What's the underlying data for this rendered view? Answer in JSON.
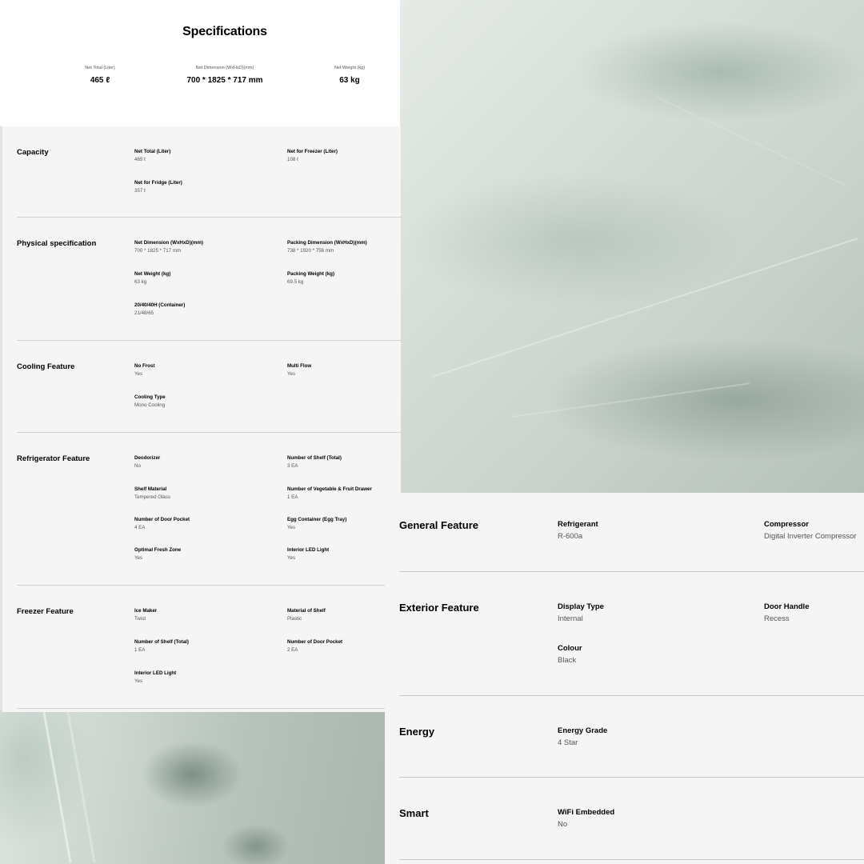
{
  "title": "Specifications",
  "summary": [
    {
      "label": "Net Total (Liter)",
      "value": "465 ℓ"
    },
    {
      "label": "Net Dimension (WxHxD)(mm)",
      "value": "700 * 1825 * 717 mm"
    },
    {
      "label": "Net Weight (kg)",
      "value": "63 kg"
    }
  ],
  "capacity": {
    "name": "Capacity",
    "items": [
      {
        "key": "Net Total (Liter)",
        "value": "465 ℓ"
      },
      {
        "key": "Net for Freezer (Liter)",
        "value": "108 ℓ"
      },
      {
        "key": "Net for Fridge (Liter)",
        "value": "357 ℓ"
      }
    ]
  },
  "physical": {
    "name": "Physical specification",
    "items": [
      {
        "key": "Net Dimension (WxHxD)(mm)",
        "value": "700 * 1825 * 717 mm"
      },
      {
        "key": "Packing Dimension (WxHxD)(mm)",
        "value": "738 * 1920 * 756 mm"
      },
      {
        "key": "Net Weight (kg)",
        "value": "63 kg"
      },
      {
        "key": "Packing Weight (kg)",
        "value": "69.5 kg"
      },
      {
        "key": "20/40/40H (Container)",
        "value": "21/48/65"
      }
    ]
  },
  "cooling": {
    "name": "Cooling Feature",
    "items": [
      {
        "key": "No Frost",
        "value": "Yes"
      },
      {
        "key": "Multi Flow",
        "value": "Yes"
      },
      {
        "key": "Cooling Type",
        "value": "Mono Cooling"
      }
    ]
  },
  "refrigerator": {
    "name": "Refrigerator Feature",
    "items": [
      {
        "key": "Deodorizer",
        "value": "No"
      },
      {
        "key": "Number of Shelf (Total)",
        "value": "3 EA"
      },
      {
        "key": "Shelf Material",
        "value": "Tempered Glass"
      },
      {
        "key": "Number of Vegetable & Fruit Drawer",
        "value": "1 EA"
      },
      {
        "key": "Number of Door Pocket",
        "value": "4 EA"
      },
      {
        "key": "Egg Container (Egg Tray)",
        "value": "Yes"
      },
      {
        "key": "Optimal Fresh Zone",
        "value": "Yes"
      },
      {
        "key": "Interior LED Light",
        "value": "Yes"
      }
    ]
  },
  "freezer": {
    "name": "Freezer Feature",
    "items": [
      {
        "key": "Ice Maker",
        "value": "Twist"
      },
      {
        "key": "Material of Shelf",
        "value": "Plastic"
      },
      {
        "key": "Number of Shelf (Total)",
        "value": "1 EA"
      },
      {
        "key": "Number of Door Pocket",
        "value": "2 EA"
      },
      {
        "key": "Interior LED Light",
        "value": "Yes"
      }
    ]
  },
  "general": {
    "name": "General Feature",
    "items": [
      {
        "key": "Refrigerant",
        "value": "R-600a"
      },
      {
        "key": "Compressor",
        "value": "Digital Inverter Compressor"
      }
    ]
  },
  "exterior": {
    "name": "Exterior Feature",
    "items": [
      {
        "key": "Display Type",
        "value": "Internal"
      },
      {
        "key": "Door Handle",
        "value": "Recess"
      },
      {
        "key": "Colour",
        "value": "Black"
      }
    ]
  },
  "energy": {
    "name": "Energy",
    "items": [
      {
        "key": "Energy Grade",
        "value": "4 Star"
      }
    ]
  },
  "smart": {
    "name": "Smart",
    "items": [
      {
        "key": "WiFi Embedded",
        "value": "No"
      }
    ]
  }
}
